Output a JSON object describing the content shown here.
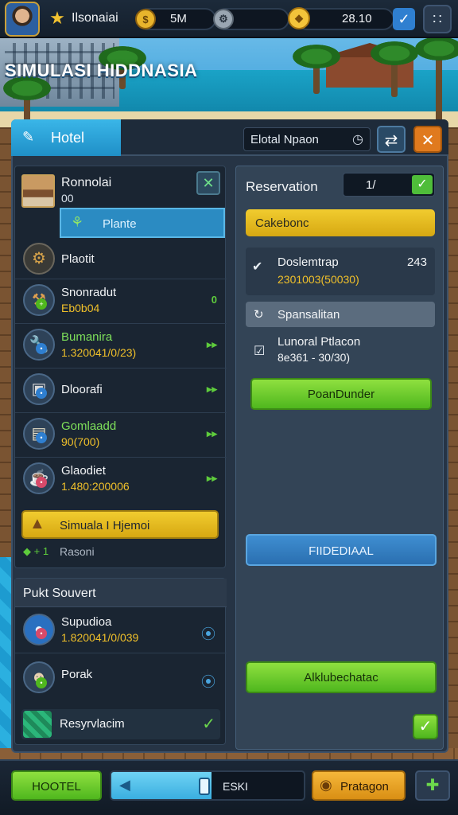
{
  "hud": {
    "player_name": "Ilsonaiai",
    "stat1_value": "5M",
    "stat2_value": "",
    "cash_value": "28.10"
  },
  "game_title": "SIMULASI HIDDNASIA",
  "panel": {
    "tab_label": "Hotel",
    "search_label": "Elotal Npaon"
  },
  "left": {
    "room": {
      "title": "Ronnolai",
      "sub": "00"
    },
    "plante_label": "Plante",
    "items": [
      {
        "title": "Plaotit",
        "sub": "",
        "mark": ""
      },
      {
        "title": "Snonradut",
        "sub": "Eb0b04",
        "mark": "0"
      },
      {
        "title": "Bumanira",
        "sub": "1.320041/0/23)",
        "mark": "▸▸"
      },
      {
        "title": "Dloorafi",
        "sub": "",
        "mark": "▸▸"
      },
      {
        "title": "Gomlaadd",
        "sub": "90(700)",
        "mark": "▸▸"
      },
      {
        "title": "Glaodiet",
        "sub": "1.480:200006",
        "mark": "▸▸"
      }
    ],
    "sim_button": "Simuala I Hjemoi",
    "rason_label": "Rasoni"
  },
  "left2": {
    "section_title": "Pukt  Souvert",
    "items": [
      {
        "title": "Supudioa",
        "sub": "1.820041/0/039"
      },
      {
        "title": "Porak",
        "sub": ""
      }
    ],
    "reserve_label": "Resyrvlacim"
  },
  "right": {
    "title": "Reservation",
    "count": "1/",
    "cake_label": "Cakebonc",
    "info": {
      "title": "Doslemtrap",
      "sub": "2301003(50030)",
      "num": "243"
    },
    "spon_label": "Spansalitan",
    "lun": {
      "title": "Lunoral Ptlacon",
      "sub": "8e361 - 30/30)"
    },
    "green1_label": "PoanDunder",
    "blue_label": "FIIDEDIAAL",
    "green2_label": "Alklubechatac"
  },
  "bottom": {
    "hotel_label": "HOOTEL",
    "progress_label": "ESKI",
    "pay_label": "Pratagon",
    "progress_fraction": 0.52
  },
  "colors": {
    "accent_blue": "#2b8bc2",
    "accent_green": "#4fb71e",
    "accent_gold": "#f1cc2f",
    "panel": "#263445"
  }
}
